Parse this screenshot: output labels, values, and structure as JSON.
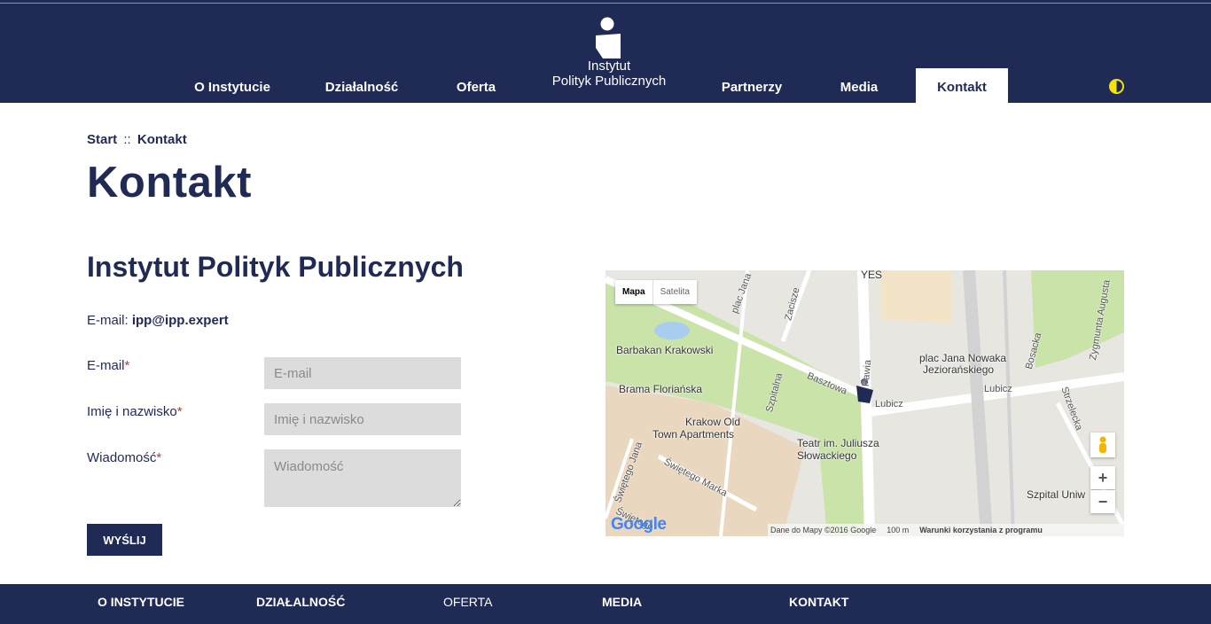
{
  "header": {
    "logo_line1": "Instytut",
    "logo_line2": "Polityk Publicznych",
    "nav": [
      {
        "label": "O Instytucie"
      },
      {
        "label": "Działalność"
      },
      {
        "label": "Oferta"
      },
      {
        "label": "Partnerzy"
      },
      {
        "label": "Media"
      },
      {
        "label": "Kontakt"
      }
    ],
    "contrast_icon": "contrast-icon"
  },
  "breadcrumb": {
    "start": "Start",
    "sep": "::",
    "current": "Kontakt"
  },
  "page_title": "Kontakt",
  "section_title": "Instytut Polityk Publicznych",
  "email_line": {
    "label": "E-mail:",
    "value": "ipp@ipp.expert"
  },
  "form": {
    "email_label": "E-mail",
    "email_placeholder": "E-mail",
    "name_label": "Imię i nazwisko",
    "name_placeholder": "Imię i nazwisko",
    "message_label": "Wiadomość",
    "message_placeholder": "Wiadomość",
    "required_mark": "*",
    "submit_label": "WYŚLIJ"
  },
  "map": {
    "type_map": "Mapa",
    "type_satellite": "Satelita",
    "labels": {
      "yes": "YES",
      "barbakan": "Barbakan Krakowski",
      "brama": "Brama Floriańska",
      "apartments1": "Krakow Old",
      "apartments2": "Town Apartments",
      "teatr1": "Teatr im. Juliusza",
      "teatr2": "Słowackiego",
      "plac1": "plac Jana Nowaka",
      "plac2": "Jeziorańskiego",
      "szpital": "Szpital Uniw",
      "lubicz1": "Lubicz",
      "lubicz2": "Lubicz",
      "basztowa": "Basztowa",
      "szpitalna": "Szpitalna",
      "zacisze": "Zacisze",
      "bosacka": "Bosacka",
      "strzelecka": "Strzelecka",
      "zygmunta": "Zygmunta Augusta",
      "plac_jana": "plac Jana",
      "swietego_marka": "Świętego Marka",
      "swietego_jana": "Świętego Jana",
      "swietego": "Świętego",
      "pawia": "Pawia"
    },
    "zoom_in": "+",
    "zoom_out": "−",
    "attribution": "Dane do Mapy ©2016 Google",
    "scale": "100 m",
    "terms": "Warunki korzystania z programu",
    "google": "Google"
  },
  "footer": [
    {
      "label": "O INSTYTUCIE"
    },
    {
      "label": "DZIAŁALNOŚĆ"
    },
    {
      "label": "OFERTA"
    },
    {
      "label": "MEDIA"
    },
    {
      "label": "KONTAKT"
    }
  ]
}
